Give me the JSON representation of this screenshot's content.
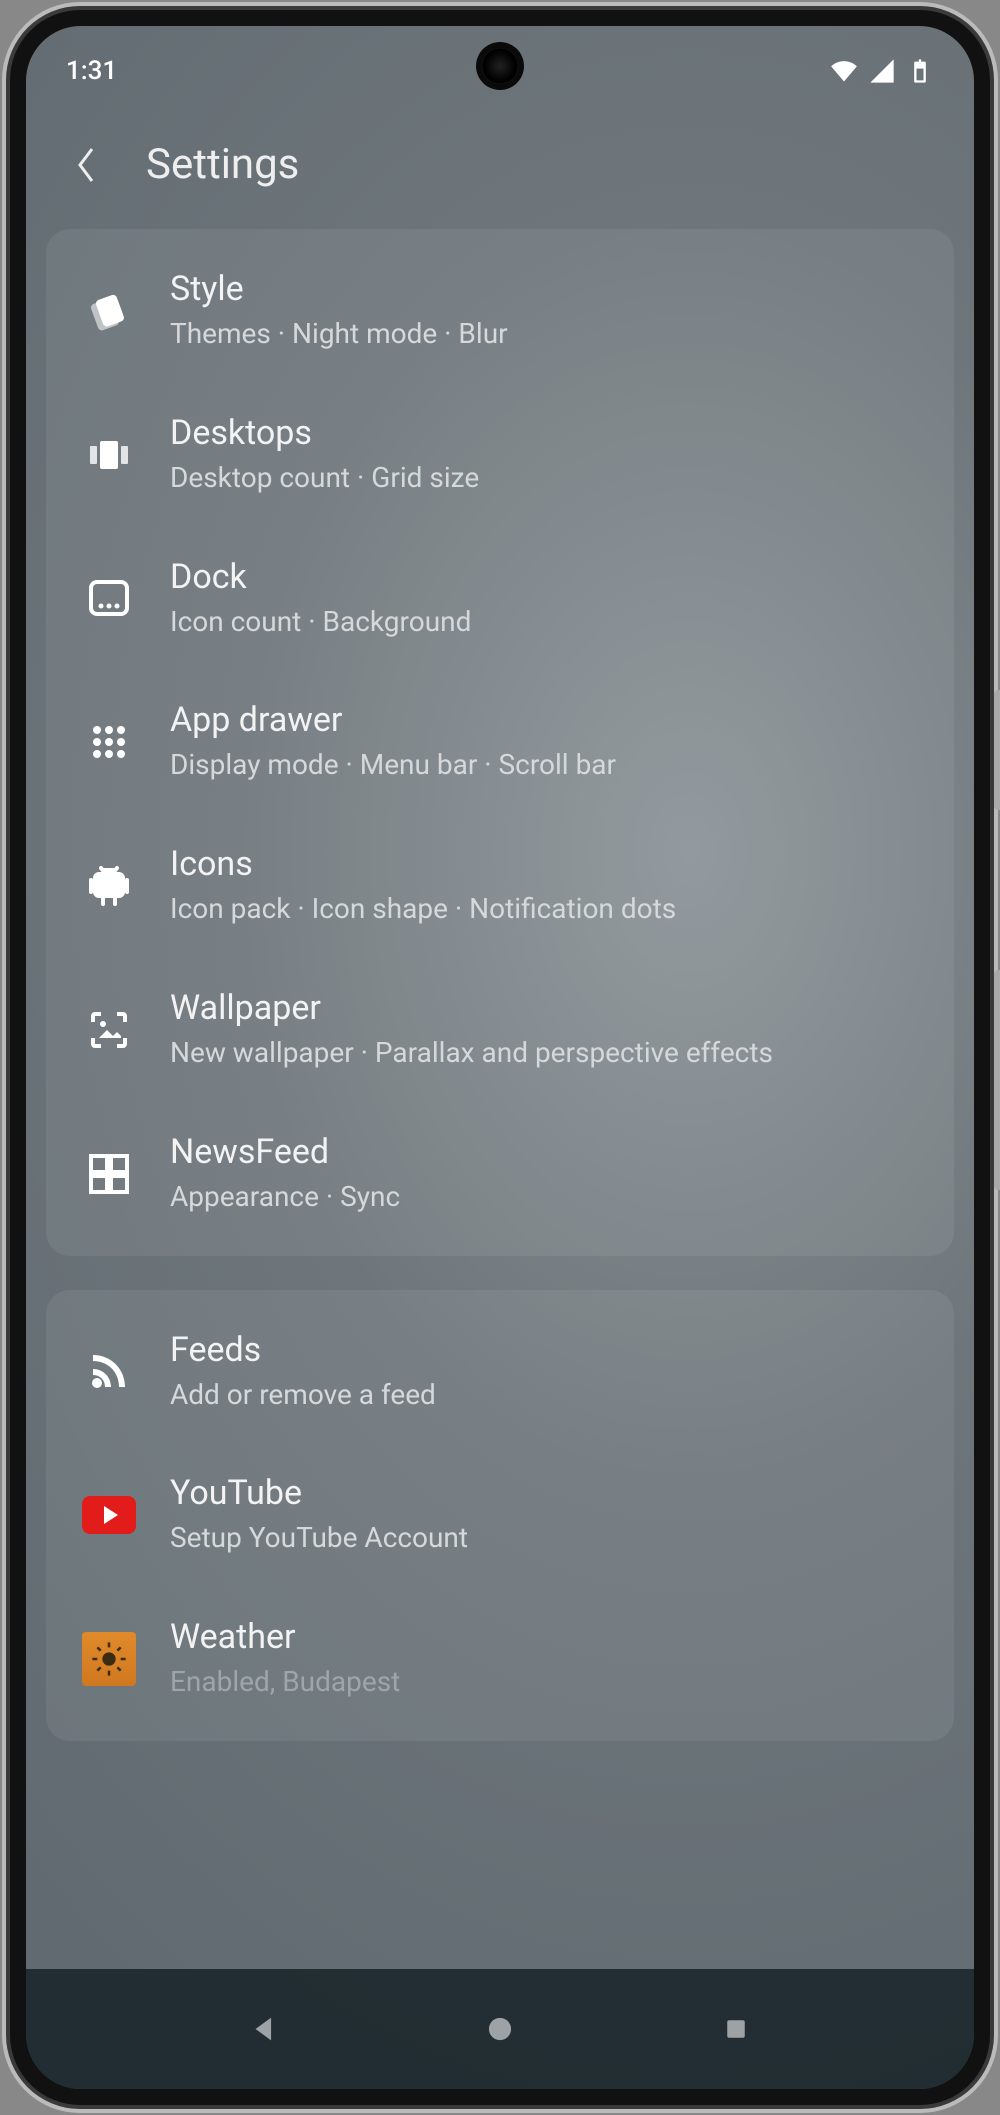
{
  "status": {
    "time": "1:31"
  },
  "header": {
    "title": "Settings"
  },
  "groups": [
    {
      "items": [
        {
          "icon": "style-icon",
          "title": "Style",
          "sub": "Themes · Night mode · Blur"
        },
        {
          "icon": "desktops-icon",
          "title": "Desktops",
          "sub": "Desktop count · Grid size"
        },
        {
          "icon": "dock-icon",
          "title": "Dock",
          "sub": "Icon count · Background"
        },
        {
          "icon": "appdrawer-icon",
          "title": "App drawer",
          "sub": "Display mode · Menu bar · Scroll bar"
        },
        {
          "icon": "android-icon",
          "title": "Icons",
          "sub": "Icon pack · Icon shape · Notification dots"
        },
        {
          "icon": "wallpaper-icon",
          "title": "Wallpaper",
          "sub": "New wallpaper · Parallax and perspective effects"
        },
        {
          "icon": "newsfeed-icon",
          "title": "NewsFeed",
          "sub": "Appearance · Sync"
        }
      ]
    },
    {
      "items": [
        {
          "icon": "rss-icon",
          "title": "Feeds",
          "sub": "Add or remove a feed"
        },
        {
          "icon": "youtube-icon",
          "title": "YouTube",
          "sub": "Setup YouTube Account"
        },
        {
          "icon": "weather-icon",
          "title": "Weather",
          "sub": "Enabled, Budapest"
        }
      ]
    }
  ]
}
